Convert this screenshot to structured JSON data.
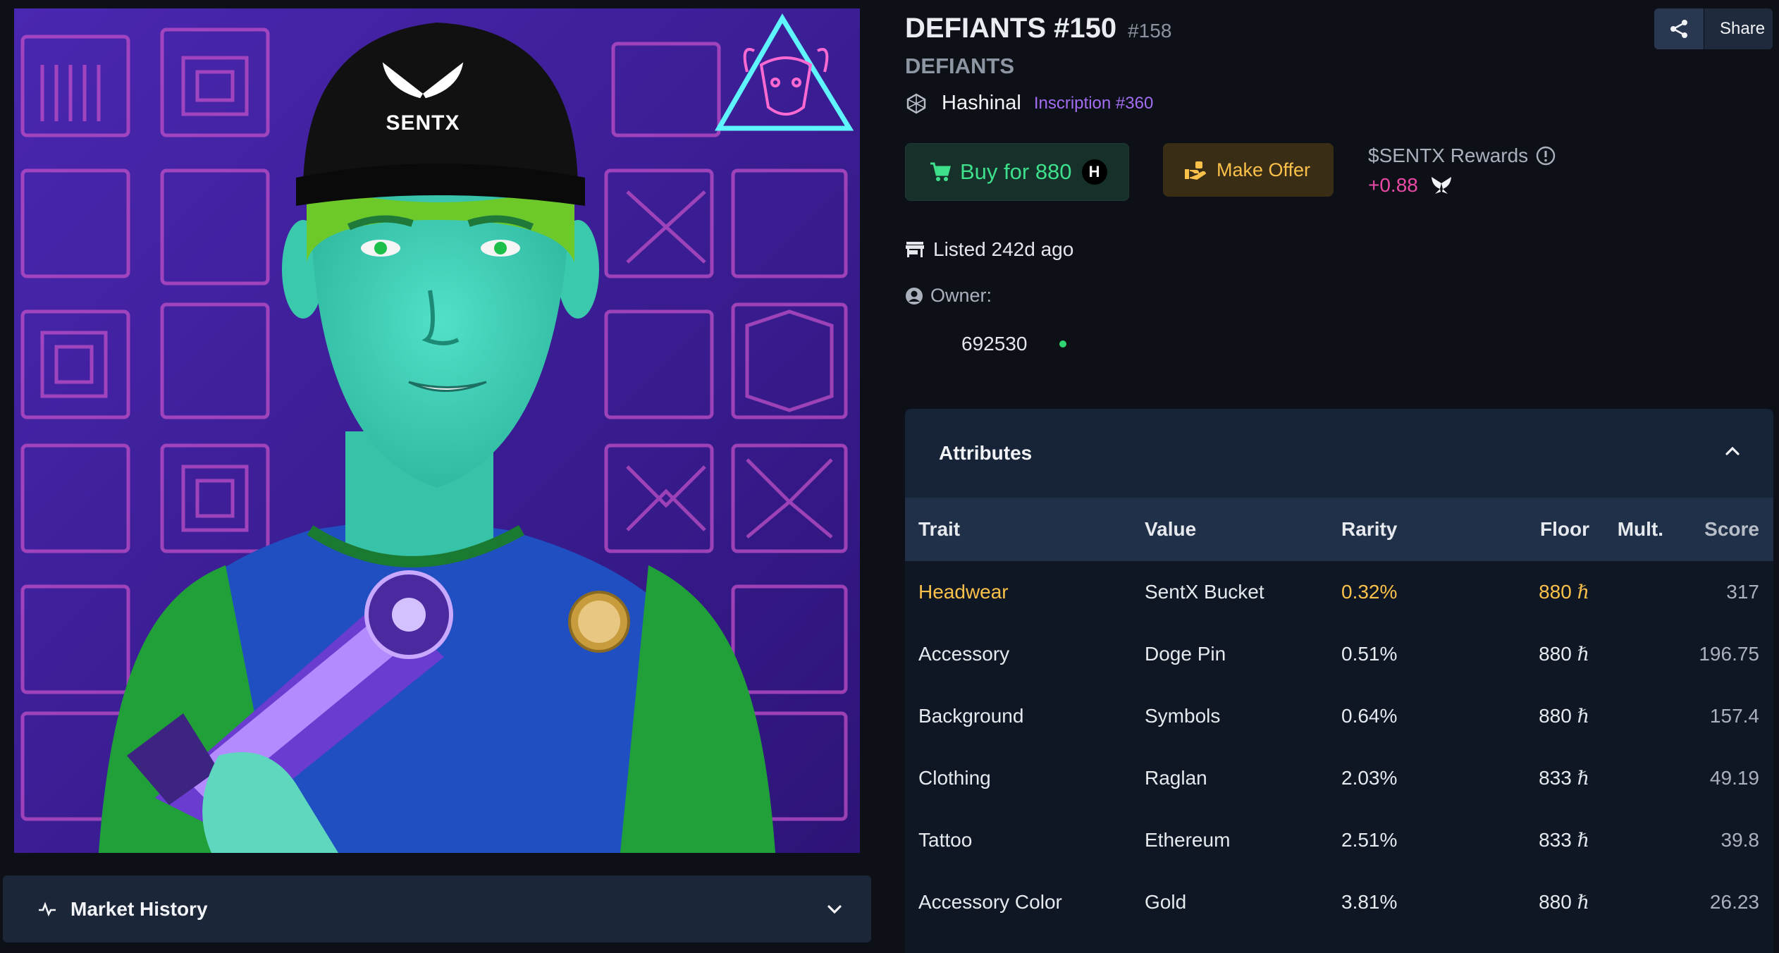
{
  "nft": {
    "title": "DEFIANTS #150",
    "rank": "#158",
    "collection": "DEFIANTS",
    "type": "Hashinal",
    "inscription": "Inscription #360",
    "artwork_icon": "sentx-cap-logo",
    "artwork_cap_text": "SENTX"
  },
  "actions": {
    "share_label": "Share",
    "buy_label": "Buy for 880",
    "buy_currency_badge": "H",
    "offer_label": "Make Offer"
  },
  "rewards": {
    "title": "$SENTX Rewards",
    "value": "+0.88"
  },
  "listing": {
    "listed": "Listed 242d ago",
    "owner_label": "Owner:",
    "owner_id": "692530"
  },
  "market_history": {
    "label": "Market History"
  },
  "attributes": {
    "title": "Attributes",
    "columns": [
      "Trait",
      "Value",
      "Rarity",
      "Floor",
      "Mult.",
      "Score"
    ],
    "rows": [
      {
        "trait": "Headwear",
        "value": "SentX Bucket",
        "rarity": "0.32%",
        "floor": "880",
        "mult": "",
        "score": "317"
      },
      {
        "trait": "Accessory",
        "value": "Doge Pin",
        "rarity": "0.51%",
        "floor": "880",
        "mult": "",
        "score": "196.75"
      },
      {
        "trait": "Background",
        "value": "Symbols",
        "rarity": "0.64%",
        "floor": "880",
        "mult": "",
        "score": "157.4"
      },
      {
        "trait": "Clothing",
        "value": "Raglan",
        "rarity": "2.03%",
        "floor": "833",
        "mult": "",
        "score": "49.19"
      },
      {
        "trait": "Tattoo",
        "value": "Ethereum",
        "rarity": "2.51%",
        "floor": "833",
        "mult": "",
        "score": "39.8"
      },
      {
        "trait": "Accessory Color",
        "value": "Gold",
        "rarity": "3.81%",
        "floor": "880",
        "mult": "",
        "score": "26.23"
      }
    ],
    "hbar_symbol": "ℏ"
  },
  "colors": {
    "buy_green": "#3ee08c",
    "offer_gold": "#f9c04a",
    "reward_pink": "#ea4aa6",
    "inscription_purple": "#a36cf2",
    "online_dot": "#2ed573"
  }
}
